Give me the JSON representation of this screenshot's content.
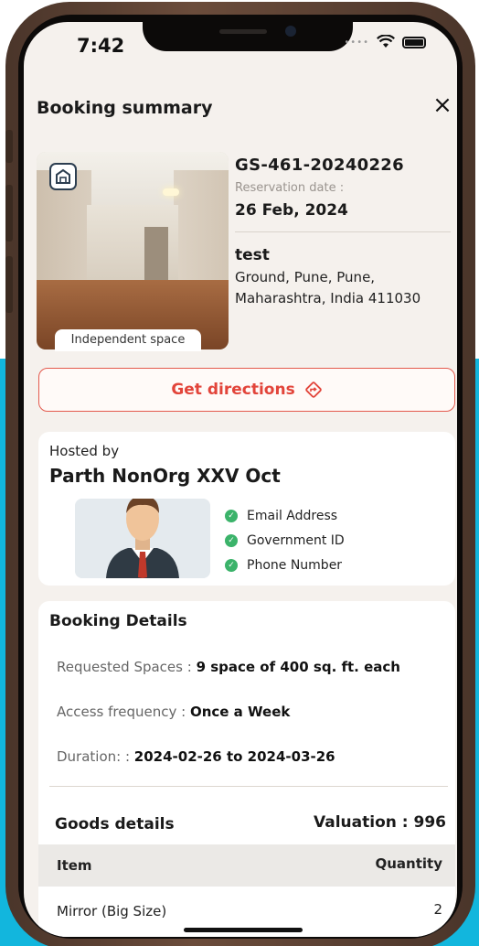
{
  "status_bar": {
    "time": "7:42"
  },
  "header": {
    "title": "Booking summary",
    "close_icon": "×"
  },
  "property": {
    "booking_id": "GS-461-20240226",
    "reservation_label": "Reservation date :",
    "reservation_date": "26 Feb, 2024",
    "name": "test",
    "address": "Ground, Pune, Pune, Maharashtra, India 411030",
    "space_type": "Independent space",
    "badge_icon": "warehouse-icon"
  },
  "directions": {
    "label": "Get directions",
    "icon": "directions-icon",
    "accent": "#e2443a"
  },
  "host": {
    "hosted_by_label": "Hosted by",
    "name": "Parth NonOrg XXV Oct",
    "verifications": [
      "Email Address",
      "Government ID",
      "Phone Number"
    ],
    "verify_color": "#3bb36a"
  },
  "booking_details": {
    "title": "Booking Details",
    "requested_label": "Requested Spaces : ",
    "requested_value": "9 space of 400 sq. ft. each",
    "frequency_label": "Access frequency : ",
    "frequency_value": "Once a Week",
    "duration_label": "Duration: : ",
    "duration_value": "2024-02-26 to 2024-03-26"
  },
  "goods": {
    "title": "Goods details",
    "valuation": "Valuation : 996",
    "columns": [
      "Item",
      "Quantity"
    ],
    "rows": [
      {
        "item": "Mirror (Big Size)",
        "quantity": "2"
      }
    ]
  }
}
